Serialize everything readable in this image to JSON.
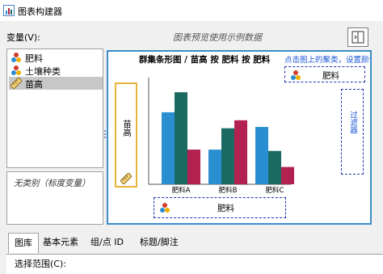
{
  "window": {
    "title": "图表构建器"
  },
  "variables_label": "变量(V):",
  "preview_hint": "图表预览使用示例数据",
  "variables": [
    {
      "label": "肥料",
      "icon": "nominal-icon"
    },
    {
      "label": "土壤种类",
      "icon": "nominal-icon"
    },
    {
      "label": "苗高",
      "icon": "scale-icon",
      "selected": true
    }
  ],
  "category_info": "无类别（标度变量）",
  "canvas": {
    "title": "群集条形图 / 苗高 按 肥料 按 肥料",
    "legend_hint": "点击图上的聚类，设置颜色",
    "legend_label": "肥料",
    "side_label": "过滤器",
    "y_label": "苗高",
    "x_label": "肥料"
  },
  "tabs": [
    {
      "label": "图库",
      "active": true
    },
    {
      "label": "基本元素"
    },
    {
      "label": "组/点 ID"
    },
    {
      "label": "标题/脚注"
    }
  ],
  "scope_label": "选择范围(C):",
  "colors": {
    "series1": "#2a8fd0",
    "series2": "#1b6a62",
    "series3": "#b2214f",
    "canvas_border": "#3c8cc7",
    "drop_zone": "#2233aa",
    "y_zone_border": "#e8b33a"
  },
  "chart_data": {
    "type": "bar",
    "categories": [
      "肥料A",
      "肥料B",
      "肥料C"
    ],
    "series": [
      {
        "values": [
          5.4,
          2.6,
          4.3
        ]
      },
      {
        "values": [
          6.9,
          4.2,
          2.5
        ]
      },
      {
        "values": [
          2.6,
          4.8,
          1.3
        ]
      }
    ],
    "ylim": [
      0,
      8
    ]
  }
}
